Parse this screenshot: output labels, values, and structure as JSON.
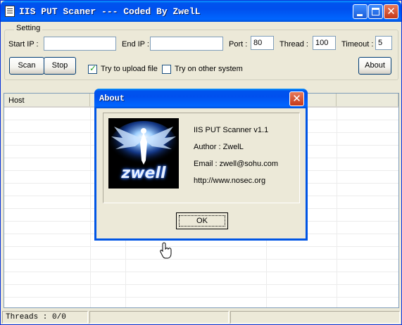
{
  "window": {
    "title": "IIS PUT Scaner --- Coded By ZwelL"
  },
  "settings": {
    "group_label": "Setting",
    "start_ip_label": "Start IP :",
    "start_ip_value": "",
    "end_ip_label": "End IP :",
    "end_ip_value": "",
    "port_label": "Port :",
    "port_value": "80",
    "thread_label": "Thread :",
    "thread_value": "100",
    "timeout_label": "Timeout :",
    "timeout_value": "5",
    "scan_label": "Scan",
    "stop_label": "Stop",
    "upload_label": "Try to upload file",
    "upload_checked": true,
    "other_system_label": "Try on other system",
    "other_system_checked": false,
    "about_label": "About"
  },
  "list": {
    "columns": [
      "Host",
      "",
      "",
      ""
    ]
  },
  "statusbar": {
    "threads": "Threads : 0/0"
  },
  "about_dialog": {
    "title": "About",
    "logo_text": "zwell",
    "lines": [
      "IIS PUT Scanner v1.1",
      "Author : ZwelL",
      "Email : zwell@sohu.com",
      "http://www.nosec.org"
    ],
    "ok_label": "OK"
  }
}
